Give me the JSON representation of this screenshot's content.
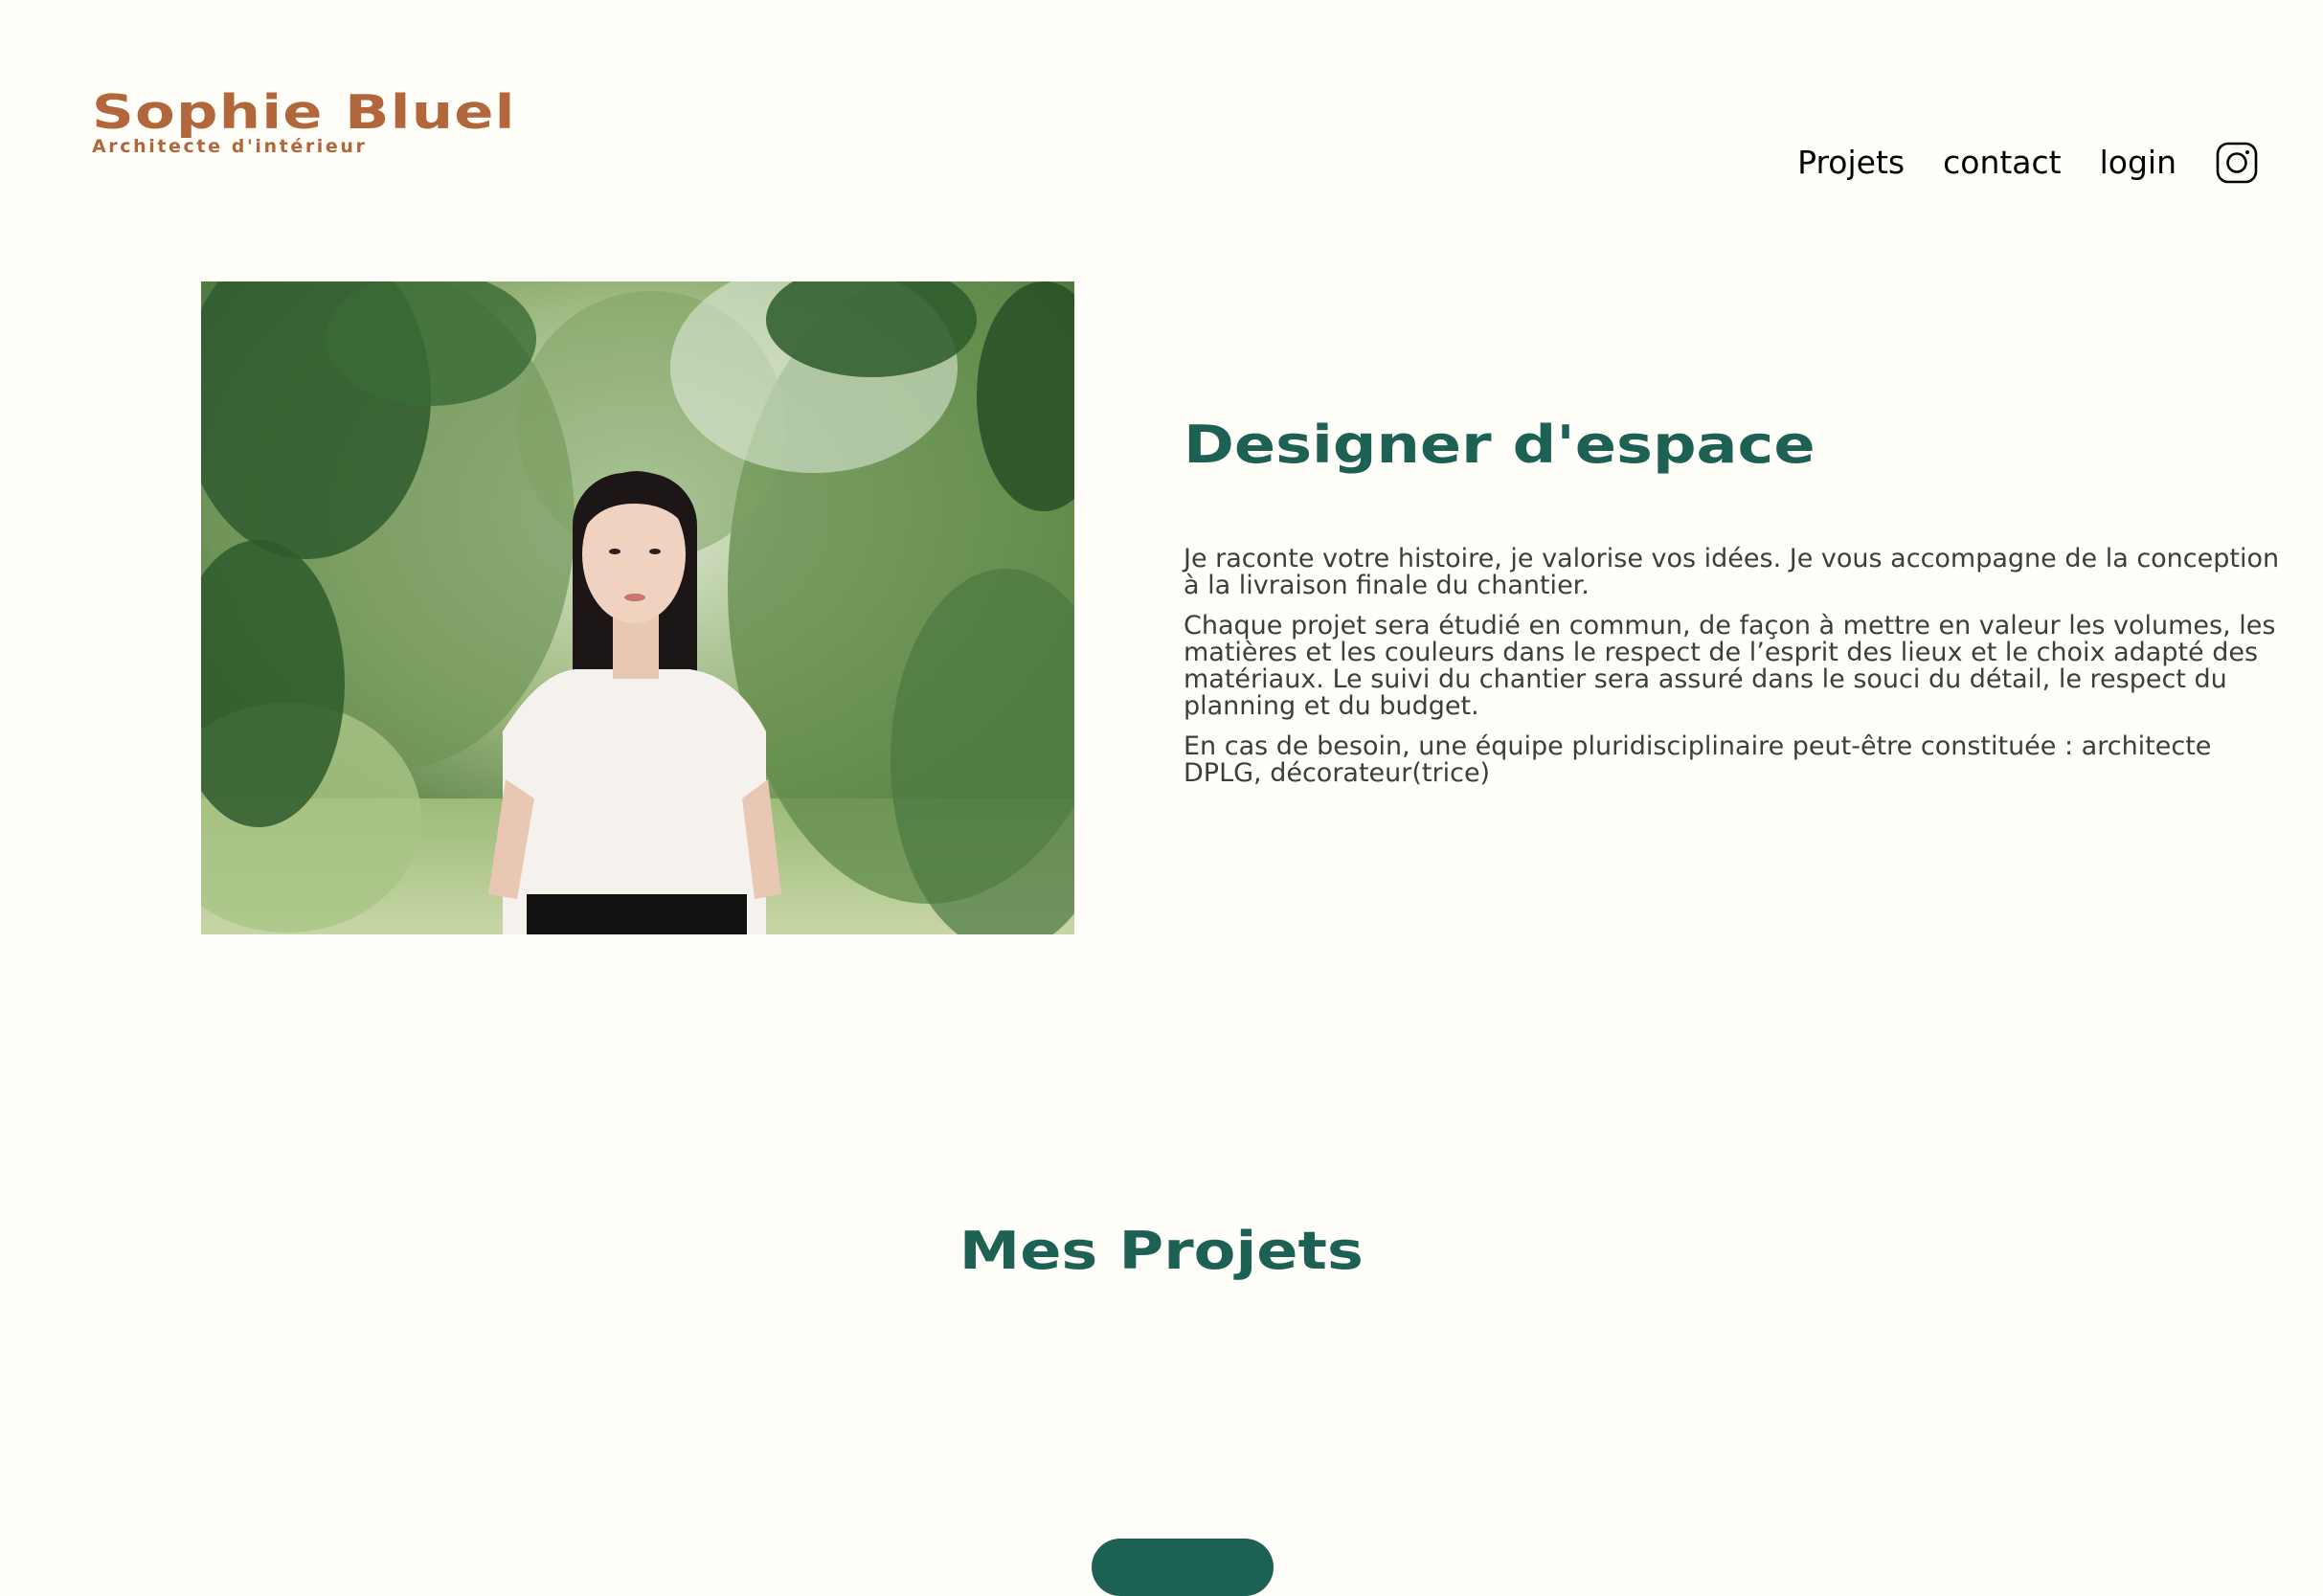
{
  "header": {
    "logo_name": "Sophie Bluel",
    "logo_subtitle": "Architecte d'intérieur",
    "nav": {
      "projects": "Projets",
      "contact": "contact",
      "login": "login",
      "instagram_icon": "instagram-icon"
    }
  },
  "intro": {
    "title": "Designer d'espace",
    "paragraphs": [
      "Je raconte votre histoire, je valorise vos idées. Je vous accompagne de la conception à la livraison finale du chantier.",
      "Chaque projet sera étudié en commun, de façon à mettre en valeur les volumes, les matières et les couleurs dans le respect de l’esprit des lieux et le choix adapté des matériaux. Le suivi du chantier sera assuré dans le souci du détail, le respect du planning et du budget.",
      "En cas de besoin, une équipe pluridisciplinaire peut-être constituée : architecte DPLG, décorateur(trice)"
    ]
  },
  "projects": {
    "title": "Mes Projets"
  },
  "colors": {
    "background": "#FFFEF8",
    "brand": "#B1663C",
    "accent": "#1D6154",
    "text": "#3D3D3D"
  }
}
